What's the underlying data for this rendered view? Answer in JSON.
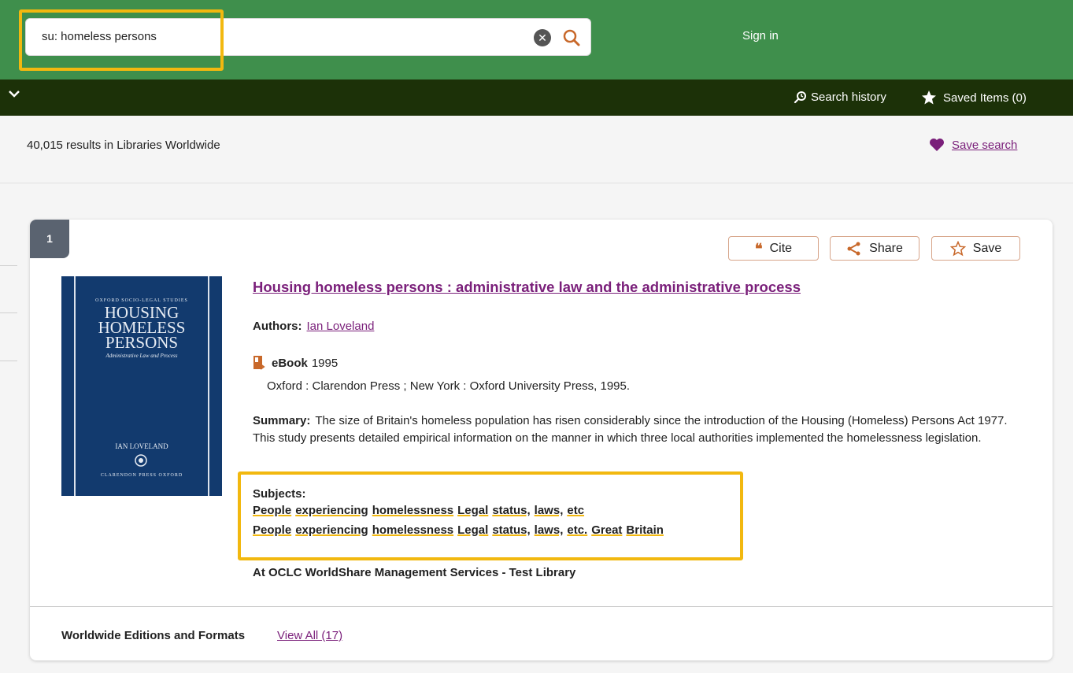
{
  "header": {
    "search_value": "su: homeless persons",
    "sign_in": "Sign in"
  },
  "nav": {
    "search_history": "Search history",
    "saved_items": "Saved Items (0)"
  },
  "results": {
    "count_text": "40,015 results in Libraries Worldwide",
    "save_search": "Save search"
  },
  "record": {
    "rank": "1",
    "actions": {
      "cite": "Cite",
      "share": "Share",
      "save": "Save"
    },
    "cover": {
      "series": "OXFORD SOCIO-LEGAL STUDIES",
      "title_line1": "HOUSING",
      "title_line2": "HOMELESS",
      "title_line3": "PERSONS",
      "subtitle": "Administrative Law and Process",
      "author": "IAN LOVELAND",
      "publisher": "CLARENDON PRESS OXFORD"
    },
    "title": "Housing homeless persons : administrative law and the administrative process",
    "authors_label": "Authors:",
    "author": "Ian Loveland",
    "format": "eBook",
    "year": "1995",
    "publication": "Oxford : Clarendon Press ; New York : Oxford University Press, 1995.",
    "summary_label": "Summary:",
    "summary": "The size of Britain's homeless population has risen considerably since the introduction of the Housing (Homeless) Persons Act 1977. This study presents detailed empirical information on the manner in which three local authorities implemented the homelessness legislation.",
    "subjects_label": "Subjects:",
    "subjects_line1": [
      "People",
      "experiencing",
      "homelessness",
      "Legal",
      "status,",
      "laws,",
      "etc"
    ],
    "subjects_line2": [
      "People",
      "experiencing",
      "homelessness",
      "Legal",
      "status,",
      "laws,",
      "etc.",
      "Great",
      "Britain"
    ],
    "holding": "At OCLC WorldShare Management Services - Test Library",
    "editions_label": "Worldwide Editions and Formats",
    "view_all": "View All (17)"
  },
  "colors": {
    "header_green": "#3f8f4c",
    "dark_bar": "#1c3108",
    "link_purple": "#7a1f7a",
    "highlight_yellow": "#f2b80f"
  }
}
